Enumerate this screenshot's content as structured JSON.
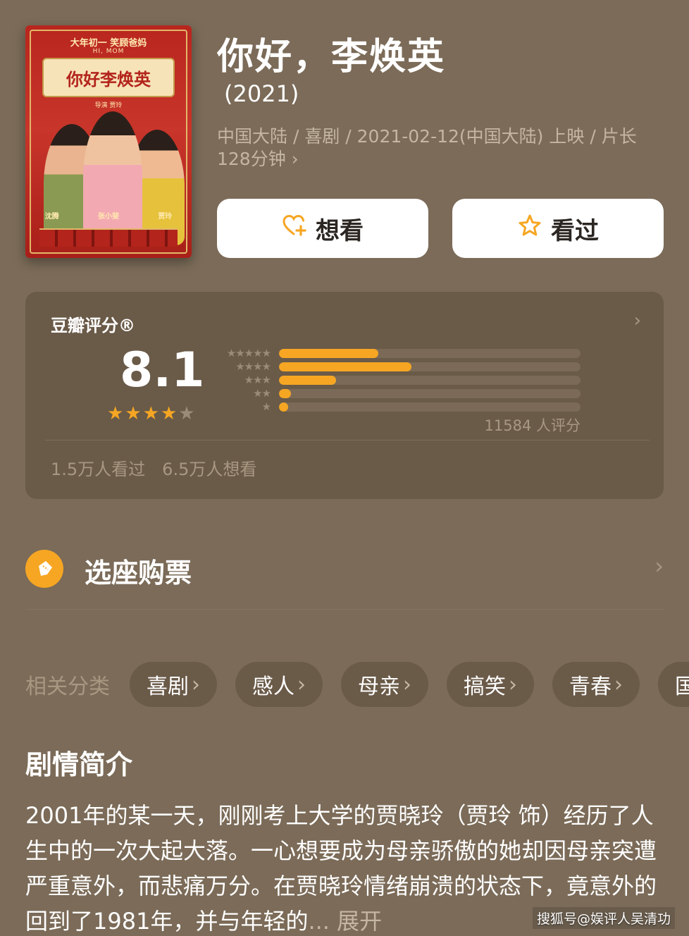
{
  "poster": {
    "tagline": "大年初一 笑顾爸妈",
    "english": "HI, MOM",
    "title": "你好李焕英",
    "director": "导演 贾玲",
    "names": [
      "沈腾",
      "张小斐",
      "贾玲"
    ]
  },
  "movie": {
    "title": "你好，李焕英",
    "year": "(2021)",
    "meta": "中国大陆 / 喜剧 / 2021-02-12(中国大陆) 上映 / 片长 128分钟",
    "meta_chevron": "›"
  },
  "actions": {
    "want_label": "想看",
    "seen_label": "看过"
  },
  "rating": {
    "label": "豆瓣评分®",
    "chevron": "›",
    "score": "8.1",
    "stars": 4,
    "star_char": "★",
    "distribution_stars": [
      "★★★★★",
      "★★★★",
      "★★★",
      "★★",
      "★"
    ],
    "distribution": [
      0.33,
      0.44,
      0.19,
      0.04,
      0.03
    ],
    "count": "11584 人评分",
    "seen": "1.5万人看过",
    "want": "6.5万人想看"
  },
  "ticket": {
    "label": "选座购票",
    "chevron": "›"
  },
  "categories": {
    "label": "相关分类",
    "chevron": "›",
    "items": [
      "喜剧",
      "感人",
      "母亲",
      "搞笑",
      "青春",
      "国"
    ]
  },
  "synopsis": {
    "title": "剧情简介",
    "text": "2001年的某一天，刚刚考上大学的贾晓玲（贾玲 饰）经历了人生中的一次大起大落。一心想要成为母亲骄傲的她却因母亲突遭严重意外，而悲痛万分。在贾晓玲情绪崩溃的状态下，竟意外的回到了1981年，并与年轻的",
    "more": "... 展开"
  },
  "watermark": "搜狐号@娱评人吴清功",
  "colors": {
    "background": "#7b6b58",
    "card": "#6a5a48",
    "accent": "#f6a623",
    "muted": "#c4b6a3"
  }
}
